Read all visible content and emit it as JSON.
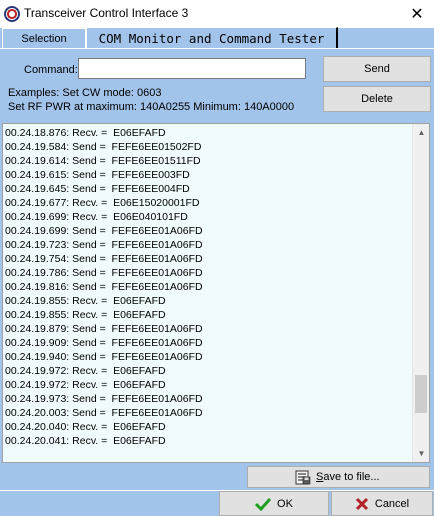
{
  "window": {
    "title": "Transceiver Control Interface 3",
    "close_glyph": "✕"
  },
  "tabs": [
    {
      "label": "Selection"
    },
    {
      "label": "COM Monitor and Command Tester"
    }
  ],
  "command": {
    "label": "Command:",
    "value": "",
    "send_label": "Send",
    "delete_label": "Delete",
    "example_line1": "Examples: Set CW mode: 0603",
    "example_line2": "Set RF PWR at maximum: 140A0255  Minimum: 140A0000"
  },
  "log": {
    "lines": [
      "00.24.18.876: Recv. =  E06EFAFD",
      "00.24.19.584: Send =  FEFE6EE01502FD",
      "00.24.19.614: Send =  FEFE6EE01511FD",
      "00.24.19.615: Send =  FEFE6EE003FD",
      "00.24.19.645: Send =  FEFE6EE004FD",
      "00.24.19.677: Recv. =  E06E15020001FD",
      "00.24.19.699: Recv. =  E06E040101FD",
      "00.24.19.699: Send =  FEFE6EE01A06FD",
      "00.24.19.723: Send =  FEFE6EE01A06FD",
      "00.24.19.754: Send =  FEFE6EE01A06FD",
      "00.24.19.786: Send =  FEFE6EE01A06FD",
      "00.24.19.816: Send =  FEFE6EE01A06FD",
      "00.24.19.855: Recv. =  E06EFAFD",
      "00.24.19.855: Recv. =  E06EFAFD",
      "00.24.19.879: Send =  FEFE6EE01A06FD",
      "00.24.19.909: Send =  FEFE6EE01A06FD",
      "00.24.19.940: Send =  FEFE6EE01A06FD",
      "00.24.19.972: Recv. =  E06EFAFD",
      "00.24.19.972: Recv. =  E06EFAFD",
      "00.24.19.973: Send =  FEFE6EE01A06FD",
      "00.24.20.003: Send =  FEFE6EE01A06FD",
      "00.24.20.040: Recv. =  E06EFAFD",
      "00.24.20.041: Recv. =  E06EFAFD",
      ""
    ],
    "scroll_position": 0.88
  },
  "save": {
    "label_underlined": "S",
    "label_rest": "ave to file..."
  },
  "footer": {
    "ok_label": "OK",
    "cancel_label": "Cancel"
  },
  "colors": {
    "panel_bg": "#a3c4ea",
    "log_bg": "#f0fbfd",
    "ok_check": "#1f9e1f",
    "cancel_x": "#b3202a"
  }
}
